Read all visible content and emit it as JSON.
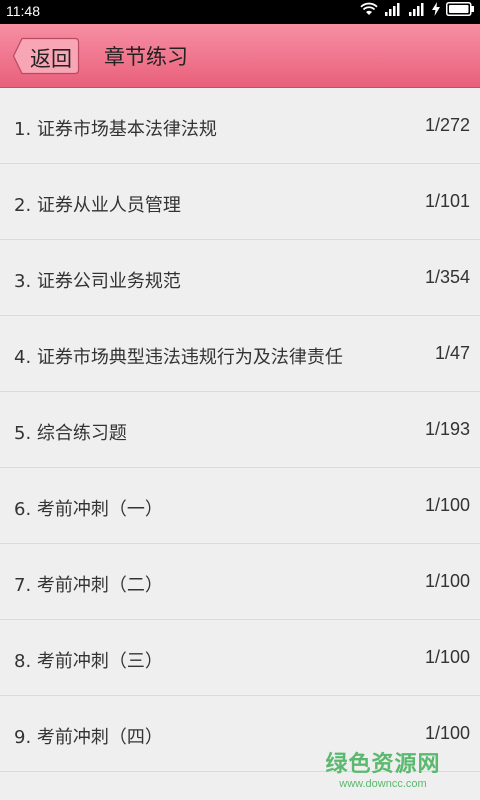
{
  "status_bar": {
    "time": "11:48",
    "icons": [
      "wifi-icon",
      "signal-icon",
      "signal-icon",
      "charging-icon",
      "battery-icon"
    ]
  },
  "header": {
    "back_label": "返回",
    "title": "章节练习",
    "accent_color": "#ec6b84"
  },
  "chapters": [
    {
      "title": "1. 证券市场基本法律法规",
      "progress": "1/272"
    },
    {
      "title": "2. 证券从业人员管理",
      "progress": "1/101"
    },
    {
      "title": "3. 证券公司业务规范",
      "progress": "1/354"
    },
    {
      "title": "4. 证券市场典型违法违规行为及法律责任",
      "progress": "1/47"
    },
    {
      "title": "5. 综合练习题",
      "progress": "1/193"
    },
    {
      "title": "6. 考前冲刺（一）",
      "progress": "1/100"
    },
    {
      "title": "7. 考前冲刺（二）",
      "progress": "1/100"
    },
    {
      "title": "8. 考前冲刺（三）",
      "progress": "1/100"
    },
    {
      "title": "9. 考前冲刺（四）",
      "progress": "1/100"
    }
  ],
  "watermark": {
    "main": "绿色资源网",
    "sub": "www.downcc.com"
  }
}
